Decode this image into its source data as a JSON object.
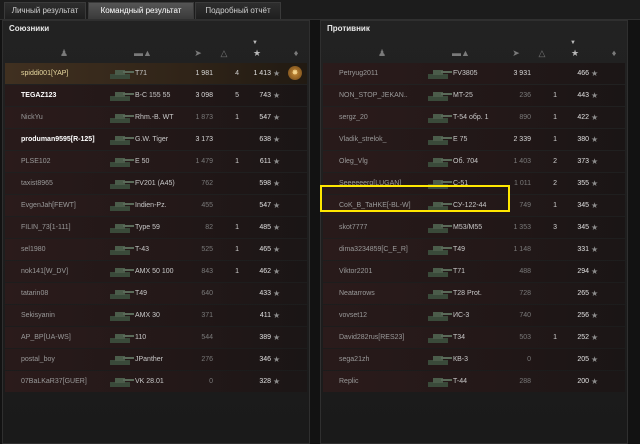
{
  "tabs": [
    {
      "label": "Личный результат"
    },
    {
      "label": "Командный результат"
    },
    {
      "label": "Подробный отчёт"
    }
  ],
  "allies": {
    "title": "Союзники",
    "rows": [
      {
        "name": "spiddi001[YAP]",
        "vehicle": "T71",
        "damage": "1 981",
        "kills": "4",
        "xp": "1 413",
        "medal": true,
        "me": true
      },
      {
        "name": "TEGAZ123",
        "vehicle": "В-С 155 55",
        "damage": "3 098",
        "kills": "5",
        "xp": "743",
        "hi": true
      },
      {
        "name": "NickYu",
        "vehicle": "Rhm.-B. WT",
        "damage": "1 873",
        "kills": "1",
        "xp": "547"
      },
      {
        "name": "produman9595[R-125]",
        "vehicle": "G.W. Tiger",
        "damage": "3 173",
        "kills": "",
        "xp": "638",
        "hi": true
      },
      {
        "name": "PLSE102",
        "vehicle": "E 50",
        "damage": "1 479",
        "kills": "1",
        "xp": "611"
      },
      {
        "name": "taxist8965",
        "vehicle": "FV201 (A45)",
        "damage": "762",
        "kills": "",
        "xp": "598"
      },
      {
        "name": "EvgenJah[FEWT]",
        "vehicle": "Indien-Pz.",
        "damage": "455",
        "kills": "",
        "xp": "547"
      },
      {
        "name": "FILIN_73[1-111]",
        "vehicle": "Type 59",
        "damage": "82",
        "kills": "1",
        "xp": "485"
      },
      {
        "name": "sel1980",
        "vehicle": "T-43",
        "damage": "525",
        "kills": "1",
        "xp": "465"
      },
      {
        "name": "nok141[W_DV]",
        "vehicle": "AMX 50 100",
        "damage": "843",
        "kills": "1",
        "xp": "462"
      },
      {
        "name": "tatarin08",
        "vehicle": "T49",
        "damage": "640",
        "kills": "",
        "xp": "433"
      },
      {
        "name": "Sekisyanin",
        "vehicle": "AMX 30",
        "damage": "371",
        "kills": "",
        "xp": "411"
      },
      {
        "name": "AP_BP[UA-WS]",
        "vehicle": "110",
        "damage": "544",
        "kills": "",
        "xp": "389"
      },
      {
        "name": "postal_boy",
        "vehicle": "JPanther",
        "damage": "276",
        "kills": "",
        "xp": "346"
      },
      {
        "name": "07BaLKaR37[GUER]",
        "vehicle": "VK 28.01",
        "damage": "0",
        "kills": "",
        "xp": "328"
      }
    ]
  },
  "enemies": {
    "title": "Противник",
    "rows": [
      {
        "name": "Petryug2011",
        "vehicle": "FV3805",
        "damage": "3 931",
        "kills": "",
        "xp": "466"
      },
      {
        "name": "NON_STOP_JEKAN..",
        "vehicle": "MT-25",
        "damage": "236",
        "kills": "1",
        "xp": "443"
      },
      {
        "name": "sergz_20",
        "vehicle": "T-54 обр. 1",
        "damage": "890",
        "kills": "1",
        "xp": "422"
      },
      {
        "name": "Vladik_strelok_",
        "vehicle": "E 75",
        "damage": "2 339",
        "kills": "1",
        "xp": "380"
      },
      {
        "name": "Oleg_Vlg",
        "vehicle": "Об. 704",
        "damage": "1 403",
        "kills": "2",
        "xp": "373"
      },
      {
        "name": "Seeeeeerg[LUGAN]",
        "vehicle": "С-51",
        "damage": "1 011",
        "kills": "2",
        "xp": "355"
      },
      {
        "name": "CoK_B_TaHKE[-BL-W]",
        "vehicle": "СУ-122-44",
        "damage": "749",
        "kills": "1",
        "xp": "345"
      },
      {
        "name": "skot7777",
        "vehicle": "M53/M55",
        "damage": "1 353",
        "kills": "3",
        "xp": "345"
      },
      {
        "name": "dima3234859[C_E_R]",
        "vehicle": "T49",
        "damage": "1 148",
        "kills": "",
        "xp": "331"
      },
      {
        "name": "Viktor2201",
        "vehicle": "T71",
        "damage": "488",
        "kills": "",
        "xp": "294"
      },
      {
        "name": "Neatarrows",
        "vehicle": "T28 Prot.",
        "damage": "728",
        "kills": "",
        "xp": "265"
      },
      {
        "name": "vovset12",
        "vehicle": "ИС-3",
        "damage": "740",
        "kills": "",
        "xp": "256"
      },
      {
        "name": "David282rus[RES23]",
        "vehicle": "T34",
        "damage": "503",
        "kills": "1",
        "xp": "252"
      },
      {
        "name": "sega21zh",
        "vehicle": "КВ-3",
        "damage": "0",
        "kills": "",
        "xp": "205"
      },
      {
        "name": "Replic",
        "vehicle": "T-44",
        "damage": "288",
        "kills": "",
        "xp": "200"
      }
    ]
  },
  "icons": {
    "player": "player-icon",
    "tank": "tank-icon",
    "damage": "damage-icon",
    "kills": "kills-icon",
    "xp": "xp-star-icon",
    "medal": "medal-icon"
  },
  "colors": {
    "highlight": "#ffe700"
  }
}
